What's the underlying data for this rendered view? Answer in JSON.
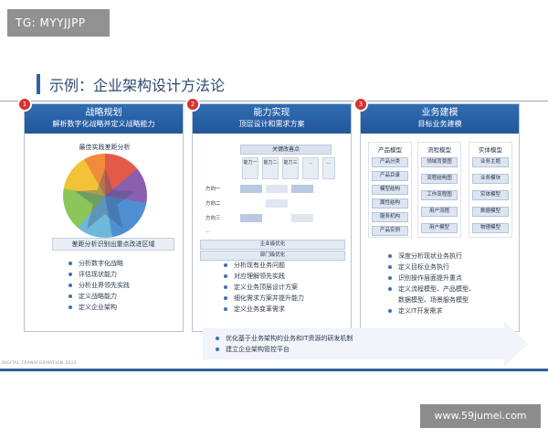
{
  "watermarks": {
    "top": "TG: MYYJJPP",
    "bottom": "www.59jumei.com"
  },
  "slide": {
    "title": "示例：企业架构设计方法论",
    "footer": "DIGITAL TRANSFORMATION 2022"
  },
  "panels": [
    {
      "number": "1",
      "title": "战略规划",
      "subtitle": "解析数字化战略并定义战略能力",
      "chart_label": "最佳实践差距分析",
      "gap_label": "差距分析识别出重点改进区域",
      "bullets": [
        "分析数字化战略",
        "评估现状能力",
        "分析业界领先实践",
        "定义战略能力",
        "定义企业架构"
      ]
    },
    {
      "number": "2",
      "title": "能力实现",
      "subtitle": "顶层设计和需求方案",
      "grid_header": "关键改善点",
      "capabilities": [
        "能力一",
        "能力二",
        "能力三",
        "...",
        "..."
      ],
      "directions": [
        "方向一",
        "方向二",
        "方向三",
        "..."
      ],
      "banner1": "企业级优化",
      "banner2": "部门级优化",
      "bullets": [
        "分析现有业务问题",
        "对应理解领先实践",
        "定义业务顶层设计方案",
        "细化需求方案并提升能力",
        "定义业务变革需求"
      ]
    },
    {
      "number": "3",
      "title": "业务建模",
      "subtitle": "目标业务建模",
      "columns": [
        {
          "header": "产品模型",
          "items": [
            "产品分类",
            "产品目录",
            "模型结构",
            "属性结构",
            "服务机构",
            "产品实例"
          ]
        },
        {
          "header": "流程模型",
          "items": [
            "领域背景图",
            "流程结构图",
            "工作流程图",
            "用户流程",
            "用户模型"
          ]
        },
        {
          "header": "实体模型",
          "items": [
            "业务主题",
            "业务模块",
            "实体模型",
            "数据模型",
            "物理模型"
          ]
        }
      ],
      "bullets": [
        "深度分析现状业务执行",
        "定义目标业务执行",
        "识别操作层面提升重点",
        "定义流程模型、产品模型、",
        "数据模型、场景服务模型",
        "定义IT开发需求"
      ]
    }
  ],
  "arrow_bullets": [
    "优化基于业务架构的业务和IT资源的研发机制",
    "建立企业架构管控平台"
  ],
  "colors": {
    "primary": "#2f6cb2",
    "accent": "#d8322d"
  }
}
